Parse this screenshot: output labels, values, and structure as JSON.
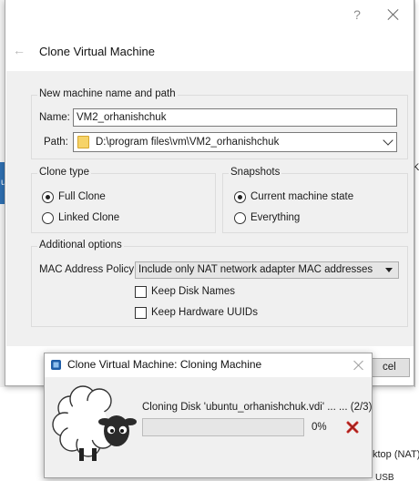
{
  "background": {
    "left_tab_text": "u",
    "frag_right_k": "K",
    "frag_cancel": "cel",
    "frag_desktop": "ktop (NAT)",
    "frag_usb": "USB"
  },
  "dialog": {
    "help_glyph": "?",
    "title": "Clone Virtual Machine",
    "name_group": {
      "label": "New machine name and path",
      "name_label": "Name:",
      "name_value": "VM2_orhanishchuk",
      "path_label": "Path:",
      "path_value": "D:\\program files\\vm\\VM2_orhanishchuk"
    },
    "clone_type": {
      "label": "Clone type",
      "options": [
        "Full Clone",
        "Linked Clone"
      ],
      "selected": "Full Clone"
    },
    "snapshots": {
      "label": "Snapshots",
      "options": [
        "Current machine state",
        "Everything"
      ],
      "selected": "Current machine state"
    },
    "additional": {
      "label": "Additional options",
      "mac_label": "MAC Address Policy:",
      "mac_value": "Include only NAT network adapter MAC addresses",
      "keep_disk_names": "Keep Disk Names",
      "keep_hw_uuids": "Keep Hardware UUIDs"
    }
  },
  "progress": {
    "title": "Clone Virtual Machine: Cloning Machine",
    "operation": "Cloning Disk 'ubuntu_orhanishchuk.vdi' ... ... (2/3)",
    "percent_text": "0%",
    "percent": 0
  },
  "colors": {
    "accent_progress": "#06b025",
    "cancel_red": "#d0312d",
    "folder": "#f6d368"
  }
}
